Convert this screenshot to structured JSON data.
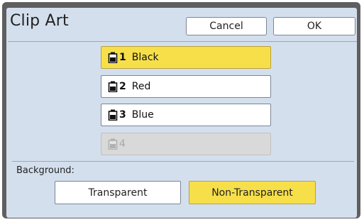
{
  "dialog": {
    "title": "Clip Art",
    "cancel_label": "Cancel",
    "ok_label": "OK"
  },
  "inks": [
    {
      "number": "1",
      "label": "Black",
      "selected": true,
      "enabled": true
    },
    {
      "number": "2",
      "label": "Red",
      "selected": false,
      "enabled": true
    },
    {
      "number": "3",
      "label": "Blue",
      "selected": false,
      "enabled": true
    },
    {
      "number": "4",
      "label": "",
      "selected": false,
      "enabled": false
    }
  ],
  "background": {
    "label": "Background:",
    "options": [
      "Transparent",
      "Non-Transparent"
    ],
    "selected": "Non-Transparent"
  },
  "colors": {
    "panel": "#d4dfee",
    "selected": "#f7df4a",
    "frame": "#5f5f5f",
    "disabled": "#d9d9d9"
  }
}
